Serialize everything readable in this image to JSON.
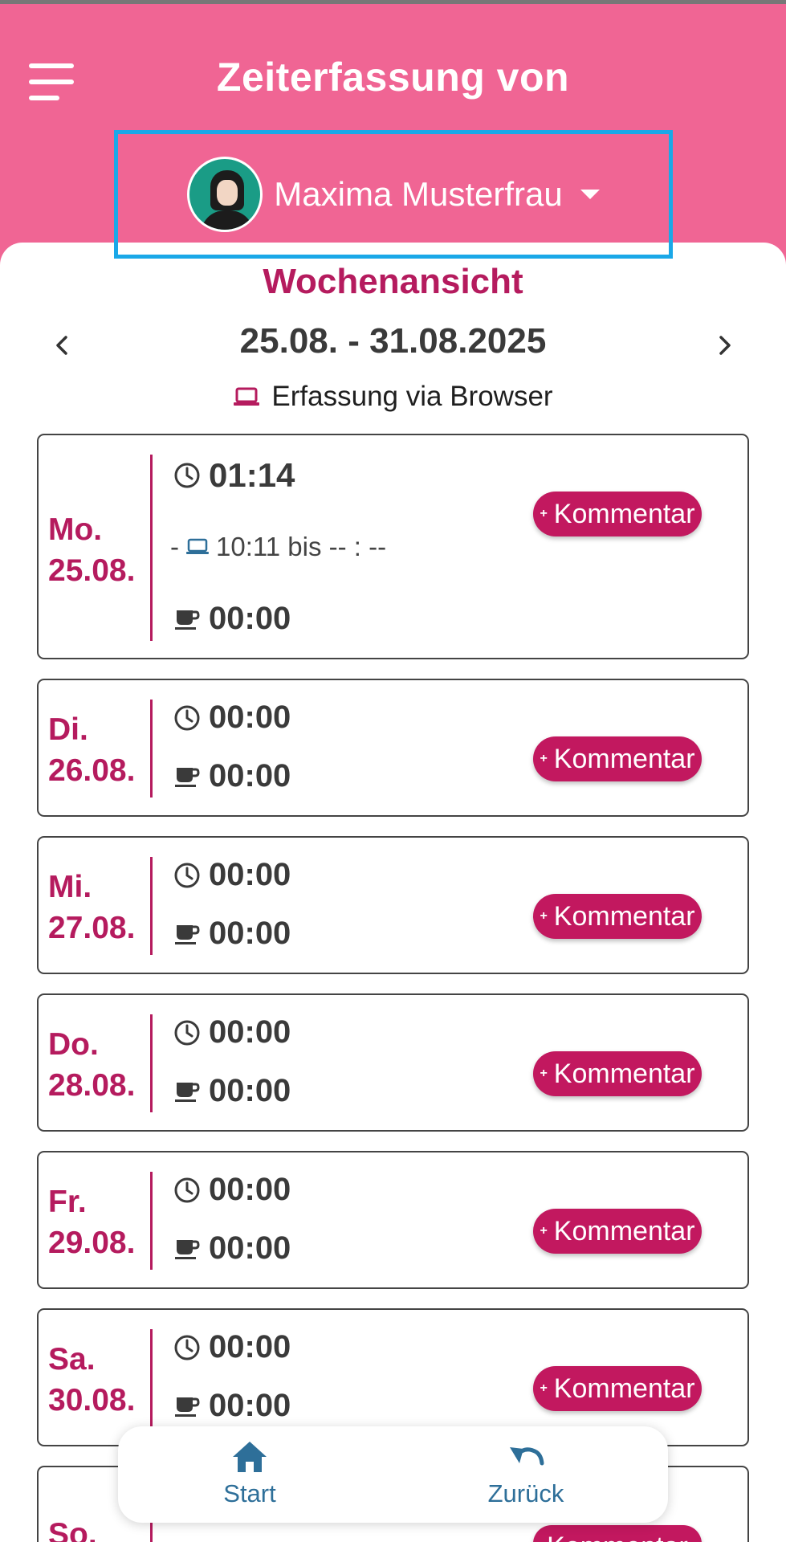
{
  "header": {
    "title": "Zeiterfassung von",
    "user_name": "Maxima Musterfrau"
  },
  "view": {
    "title": "Wochenansicht",
    "range": "25.08. - 31.08.2025",
    "source": "Erfassung via Browser"
  },
  "days": [
    {
      "weekday": "Mo.",
      "date": "25.08.",
      "work_time": "01:14",
      "entry": "- ",
      "entry_time": "10:11 bis -- : --",
      "break_time": "00:00",
      "comment_label": "Kommentar"
    },
    {
      "weekday": "Di.",
      "date": "26.08.",
      "work_time": "00:00",
      "break_time": "00:00",
      "comment_label": "Kommentar"
    },
    {
      "weekday": "Mi.",
      "date": "27.08.",
      "work_time": "00:00",
      "break_time": "00:00",
      "comment_label": "Kommentar"
    },
    {
      "weekday": "Do.",
      "date": "28.08.",
      "work_time": "00:00",
      "break_time": "00:00",
      "comment_label": "Kommentar"
    },
    {
      "weekday": "Fr.",
      "date": "29.08.",
      "work_time": "00:00",
      "break_time": "00:00",
      "comment_label": "Kommentar"
    },
    {
      "weekday": "Sa.",
      "date": "30.08.",
      "work_time": "00:00",
      "break_time": "00:00",
      "comment_label": "Kommentar"
    },
    {
      "weekday": "So.",
      "comment_label": "Kommentar"
    }
  ],
  "comment_plus": "+",
  "bottom_nav": {
    "start_label": "Start",
    "back_label": "Zurück"
  },
  "colors": {
    "header_pink": "#f06594",
    "accent_magenta": "#b51b5e",
    "button_magenta": "#c2185f",
    "highlight_blue": "#1aa8e8",
    "nav_blue": "#2e6f99"
  },
  "icons": [
    "menu-icon",
    "avatar",
    "caret-down-icon",
    "chevron-left-icon",
    "chevron-right-icon",
    "laptop-icon",
    "clock-icon",
    "coffee-icon",
    "home-icon",
    "undo-icon"
  ]
}
